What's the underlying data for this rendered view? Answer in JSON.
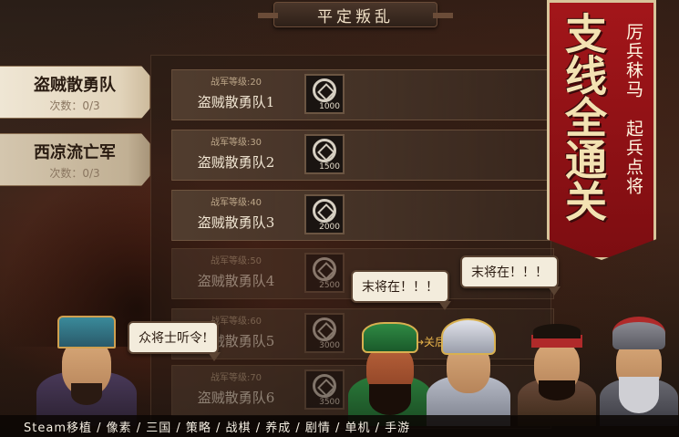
{
  "title": "平定叛乱",
  "tabs": [
    {
      "name": "盗贼散勇队",
      "count": "次数：0/3"
    },
    {
      "name": "西凉流亡军",
      "count": "次数：0/3"
    }
  ],
  "missions": [
    {
      "level": "战军等级:20",
      "name": "盗贼散勇队1",
      "reward": "1000"
    },
    {
      "level": "战军等级:30",
      "name": "盗贼散勇队2",
      "reward": "1500"
    },
    {
      "level": "战军等级:40",
      "name": "盗贼散勇队3",
      "reward": "2000"
    },
    {
      "level": "战军等级:50",
      "name": "盗贼散勇队4",
      "reward": "2500"
    },
    {
      "level": "战军等级:60",
      "name": "盗贼散勇队5",
      "reward": "3000"
    },
    {
      "level": "战军等级:70",
      "name": "盗贼散勇队6",
      "reward": "3500"
    }
  ],
  "banner": {
    "main": "支线全通关",
    "sub1": "厉兵秣马",
    "sub2": "起兵点将"
  },
  "bubbles": {
    "lord": "众将士听令!",
    "general1": "末将在！！！",
    "general2": "末将在！！！"
  },
  "next_hint": "→关后",
  "tagline": "Steam移植 / 像素 / 三国 / 策略 / 战棋 / 养成 / 剧情 / 单机 / 手游",
  "colors": {
    "banner": "#a3161a",
    "banner_text": "#f3e2b2"
  }
}
